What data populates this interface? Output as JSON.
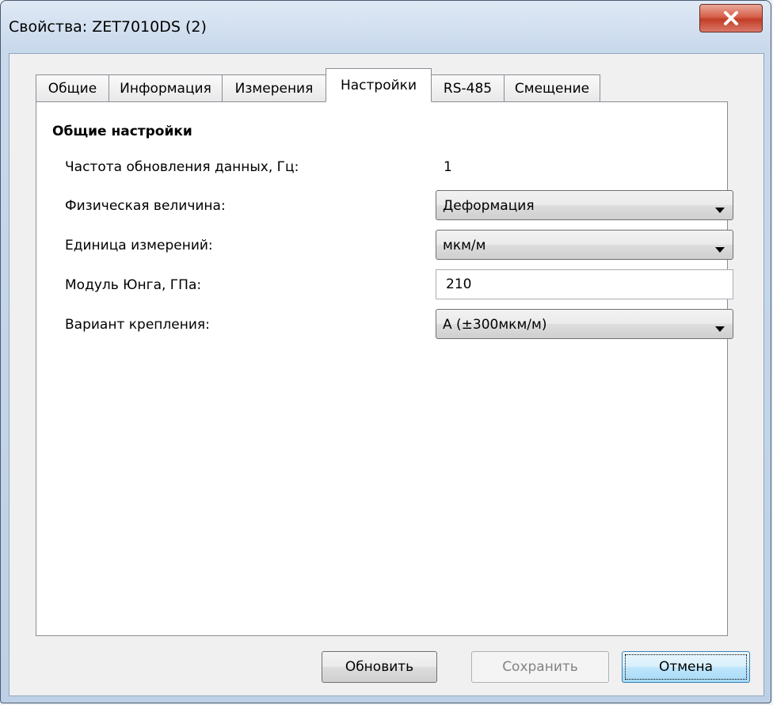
{
  "window": {
    "title": "Свойства: ZET7010DS (2)",
    "close_icon": "close-icon"
  },
  "tabs": [
    {
      "label": "Общие",
      "active": false
    },
    {
      "label": "Информация",
      "active": false
    },
    {
      "label": "Измерения",
      "active": false
    },
    {
      "label": "Настройки",
      "active": true
    },
    {
      "label": "RS-485",
      "active": false
    },
    {
      "label": "Смещение",
      "active": false
    }
  ],
  "settings": {
    "section_title": "Общие настройки",
    "update_rate": {
      "label": "Частота обновления данных, Гц:",
      "value": "1"
    },
    "physical_quantity": {
      "label": "Физическая величина:",
      "value": "Деформация"
    },
    "unit": {
      "label": "Единица измерений:",
      "value": "мкм/м"
    },
    "young_modulus": {
      "label": "Модуль Юнга, ГПа:",
      "value": "210"
    },
    "mount_variant": {
      "label": "Вариант крепления:",
      "value": "А (±300мкм/м)"
    }
  },
  "buttons": {
    "refresh": "Обновить",
    "save": "Сохранить",
    "cancel": "Отмена"
  },
  "colors": {
    "close_button": "#c23e26",
    "default_button_border": "#3c7fb1"
  }
}
